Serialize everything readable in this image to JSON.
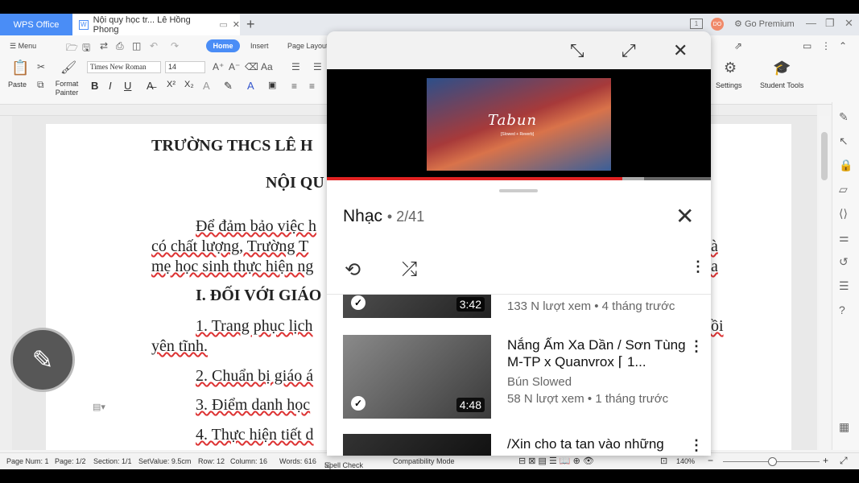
{
  "tabs": {
    "app": "WPS Office",
    "document": "Nội quy học tr... Lê Hồng Phong",
    "add": "+",
    "premium": "Go Premium"
  },
  "ribbon": {
    "menu": "Menu",
    "home": "Home",
    "insert": "Insert",
    "page_layout": "Page Layout",
    "paste": "Paste",
    "format_painter": "Format Painter",
    "font_name": "Times New Roman",
    "font_size": "14",
    "settings": "Settings",
    "student_tools": "Student Tools"
  },
  "document": {
    "lines": [
      "TRƯỜNG THCS LÊ H",
      "NỘI QU",
      "Để đảm bảo việc h",
      "có chất lượng, Trường T",
      "mẹ học sinh thực hiện ng",
      "I. ĐỐI VỚI GIÁO",
      "1. Trang phục lịch",
      "yên tĩnh.",
      "2. Chuẩn bị giáo á",
      "3. Điểm danh học",
      "4. Thực hiện tiết d"
    ],
    "right_fragments": [
      "à",
      "a",
      "ồi"
    ]
  },
  "status_bar": {
    "page_num": "Page Num: 1",
    "page": "Page: 1/2",
    "section": "Section: 1/1",
    "setvalue": "SetValue: 9.5cm",
    "row": "Row: 12",
    "column": "Column: 16",
    "words": "Words: 616",
    "spell_check": "Spell Check",
    "compat": "Compatibility Mode",
    "zoom": "140%"
  },
  "youtube": {
    "video_title": "Tabun",
    "video_subtitle": "[Slowed + Reverb]",
    "playlist_title": "Nhạc",
    "playlist_count": "2/41",
    "progress": 0.77,
    "items": [
      {
        "duration": "3:42",
        "title": "",
        "channel": "",
        "meta": "133 N lượt xem • 4 tháng trước"
      },
      {
        "duration": "4:48",
        "title": "Nắng Ấm Xa Dần / Sơn Tùng M-TP x Quanvrox ⌈ 1...",
        "channel": "Bún Slowed",
        "meta": "58 N lượt xem • 1 tháng trước"
      },
      {
        "duration": "",
        "title": "/Xin cho ta tan vào những",
        "channel": "",
        "meta": ""
      }
    ]
  },
  "colors": {
    "accent": "#4a8df6",
    "progress": "#e22222"
  }
}
